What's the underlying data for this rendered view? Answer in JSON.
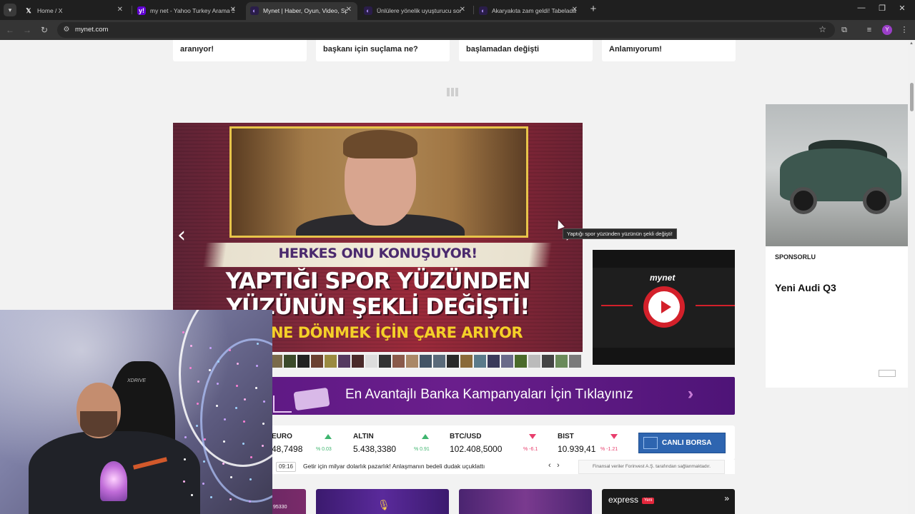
{
  "browser": {
    "tabs": [
      {
        "title": "Home / X",
        "favicon": "x-logo-icon",
        "active": false
      },
      {
        "title": "my net - Yahoo Turkey Arama S",
        "favicon": "yahoo-icon",
        "active": false
      },
      {
        "title": "Mynet | Haber, Oyun, Video, Sp",
        "favicon": "mynet-icon",
        "active": true
      },
      {
        "title": "Ünlülere yönelik uyuşturucu sor",
        "favicon": "mynet-icon",
        "active": false
      },
      {
        "title": "Akaryakıta zam geldi! Tabelada",
        "favicon": "mynet-icon",
        "active": false
      }
    ],
    "url": "mynet.com",
    "profile_initial": "Y"
  },
  "page": {
    "top_news": [
      {
        "title": "aranıyor!"
      },
      {
        "title": "başkanı için suçlama ne?"
      },
      {
        "title": "başlamadan değişti"
      },
      {
        "title": "Anlamıyorum!"
      }
    ],
    "slider": {
      "kicker": "HERKES ONU KONUŞUYOR!",
      "headline_line1": "YAPTIĞI SPOR YÜZÜNDEN",
      "headline_line2": "YÜZÜNÜN ŞEKLİ DEĞİŞTİ!",
      "headline_line3": "HALİNE DÖNMEK İÇİN ÇARE ARIYOR",
      "tooltip": "Yaptığı spor yüzünden yüzünün şekli değişti!",
      "prev_icon": "chevron-left-icon",
      "next_icon": "chevron-right-icon",
      "thumbnail_count": 23
    },
    "video_widget": {
      "logo": "mynet",
      "play_icon": "play-icon"
    },
    "sponsor": {
      "label": "SPONSORLU",
      "title": "Yeni Audi Q3"
    },
    "banner": {
      "text": "En Avantajlı Banka Kampanyaları İçin Tıklayınız"
    },
    "markets": [
      {
        "name": "EURO",
        "value": "48,7498",
        "change": "% 0.03",
        "direction": "up"
      },
      {
        "name": "ALTIN",
        "value": "5.438,3380",
        "change": "% 0.91",
        "direction": "up"
      },
      {
        "name": "BTC/USD",
        "value": "102.408,5000",
        "change": "% -6.1",
        "direction": "down"
      },
      {
        "name": "BIST",
        "value": "10.939,41",
        "change": "% -1.21",
        "direction": "down"
      }
    ],
    "live_market_button": "CANLI BORSA",
    "ticker": {
      "time": "09:16",
      "headline": "Getir için milyar dolarlık pazarlık! Anlaşmanın bedeli dudak uçuklattı",
      "source": "Finansal veriler Forinvest A.Ş. tarafından sağlanmaktadır."
    },
    "bottom_row": {
      "express_logo": "express",
      "express_badge": "Yeni",
      "podcast_count": "95330"
    }
  },
  "colors": {
    "accent_purple": "#5a1781",
    "mynet_red": "#d3202a",
    "up": "#3fb56f",
    "down": "#e83e6d",
    "borsa_blue": "#2e65b0"
  }
}
